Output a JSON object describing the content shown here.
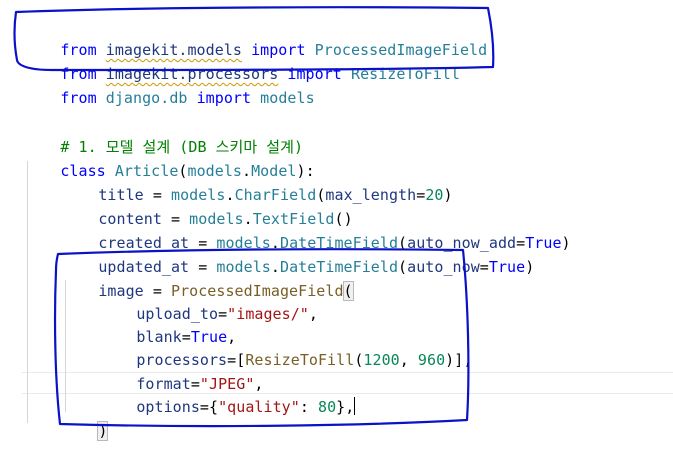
{
  "colors": {
    "keyword": "#0000ff",
    "function": "#795e26",
    "class": "#267f99",
    "string": "#a31515",
    "number": "#098658",
    "comment": "#008000",
    "identifier": "#1f377f",
    "annotation_pen": "#0a12c8"
  },
  "code": {
    "l1": {
      "from": "from",
      "module": "imagekit.models",
      "import": "import",
      "name": "ProcessedImageField"
    },
    "l2": {
      "from": "from",
      "module": "imagekit.processors",
      "import": "import",
      "name": "ResizeToFill"
    },
    "l3": {
      "from": "from",
      "module": "django.db",
      "import": "import",
      "name": "models"
    },
    "l5": {
      "comment": "# 1. 모델 설계 (DB 스키마 설계)"
    },
    "l6": {
      "class_kw": "class",
      "class_name": "Article",
      "open": "(",
      "base_obj": "models",
      "dot": ".",
      "base_cls": "Model",
      "close": "):"
    },
    "l7": {
      "var": "title",
      "eq": " = ",
      "obj": "models",
      "dot": ".",
      "fn": "CharField",
      "open": "(",
      "param": "max_length",
      "peq": "=",
      "num": "20",
      "close": ")"
    },
    "l8": {
      "var": "content",
      "eq": " = ",
      "obj": "models",
      "dot": ".",
      "fn": "TextField",
      "parens": "()"
    },
    "l9": {
      "var": "created_at",
      "eq": " = ",
      "obj": "models",
      "dot": ".",
      "fn": "DateTimeField",
      "open": "(",
      "param": "auto_now_add",
      "peq": "=",
      "val": "True",
      "close": ")"
    },
    "l10": {
      "var": "updated_at",
      "eq": " = ",
      "obj": "models",
      "dot": ".",
      "fn": "DateTimeField",
      "open": "(",
      "param": "auto_now",
      "peq": "=",
      "val": "True",
      "close": ")"
    },
    "l11": {
      "var": "image",
      "eq": " = ",
      "fn": "ProcessedImageField",
      "open": "("
    },
    "l12": {
      "param": "upload_to",
      "peq": "=",
      "str": "\"images/\"",
      "comma": ","
    },
    "l13": {
      "param": "blank",
      "peq": "=",
      "val": "True",
      "comma": ","
    },
    "l14": {
      "param": "processors",
      "peq": "=",
      "lbr": "[",
      "fn": "ResizeToFill",
      "open": "(",
      "n1": "1200",
      "sep": ", ",
      "n2": "960",
      "close": ")",
      "rbr": "],",
      "comma": ""
    },
    "l15": {
      "param": "format",
      "peq": "=",
      "str": "\"JPEG\"",
      "comma": ","
    },
    "l16": {
      "param": "options",
      "peq": "=",
      "lbrace": "{",
      "key": "\"quality\"",
      "colon": ": ",
      "num": "80",
      "rbrace": "},",
      "comma": ""
    },
    "l17": {
      "close": ")"
    }
  }
}
